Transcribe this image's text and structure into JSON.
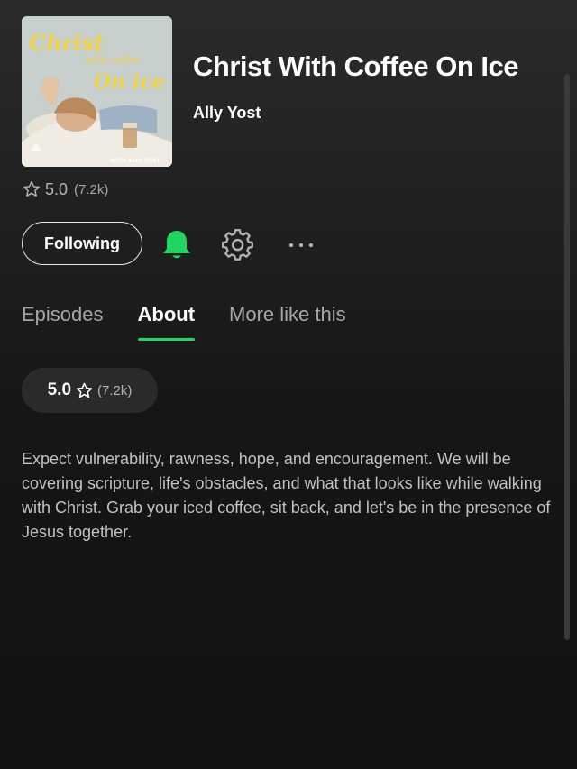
{
  "podcast": {
    "title": "Christ With Coffee On Ice",
    "author": "Ally Yost",
    "rating": "5.0",
    "rating_count": "(7.2k)"
  },
  "cover_art": {
    "text_line1": "Christ",
    "text_line2": "with coffee",
    "text_line3": "On ice",
    "footer": "WITH ALLY YOST"
  },
  "actions": {
    "follow_label": "Following",
    "bell_icon": "bell-icon",
    "gear_icon": "gear-icon",
    "more_icon": "more-dots-icon"
  },
  "tabs": [
    {
      "label": "Episodes",
      "active": false
    },
    {
      "label": "About",
      "active": true
    },
    {
      "label": "More like this",
      "active": false
    }
  ],
  "about": {
    "rating_value": "5.0",
    "rating_count": "(7.2k)",
    "description": "Expect vulnerability, rawness, hope, and encouragement. We will be covering scripture, life's obstacles, and what that looks like while walking with Christ. Grab your iced coffee, sit back, and let's be in the presence of Jesus together."
  },
  "colors": {
    "accent": "#1ed760",
    "background": "#121212",
    "text_muted": "#a7a7a7"
  }
}
